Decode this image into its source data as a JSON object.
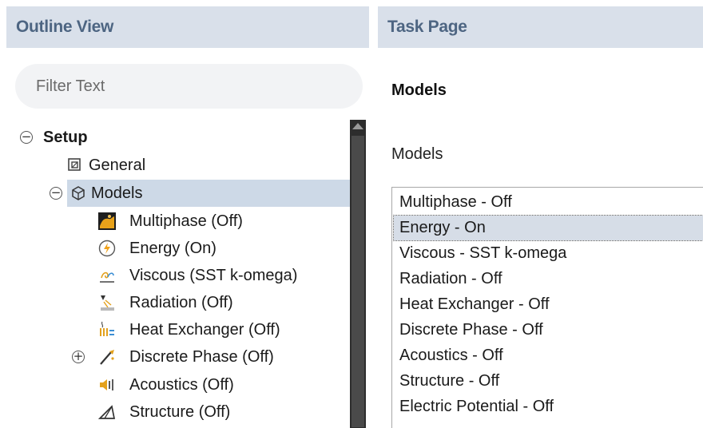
{
  "outline": {
    "title": "Outline View",
    "filter_placeholder": "Filter Text",
    "tree": [
      {
        "label": "Setup",
        "expander": "−",
        "icon": "none"
      },
      {
        "label": "General",
        "icon": "general-icon"
      },
      {
        "label": "Models",
        "expander": "−",
        "icon": "models-icon",
        "selected": true
      },
      {
        "label": "Multiphase (Off)",
        "icon": "multiphase-icon"
      },
      {
        "label": "Energy (On)",
        "icon": "energy-icon"
      },
      {
        "label": "Viscous (SST k-omega)",
        "icon": "viscous-icon"
      },
      {
        "label": "Radiation (Off)",
        "icon": "radiation-icon"
      },
      {
        "label": "Heat Exchanger (Off)",
        "icon": "heat-exchanger-icon"
      },
      {
        "label": "Discrete Phase (Off)",
        "expander": "+",
        "icon": "discrete-phase-icon"
      },
      {
        "label": "Acoustics (Off)",
        "icon": "acoustics-icon"
      },
      {
        "label": "Structure (Off)",
        "icon": "structure-icon"
      }
    ]
  },
  "task": {
    "title": "Task Page",
    "heading": "Models",
    "list_label": "Models",
    "items": [
      {
        "label": "Multiphase - Off"
      },
      {
        "label": "Energy - On",
        "selected": true
      },
      {
        "label": "Viscous - SST k-omega"
      },
      {
        "label": "Radiation - Off"
      },
      {
        "label": "Heat Exchanger - Off"
      },
      {
        "label": "Discrete Phase - Off"
      },
      {
        "label": "Acoustics - Off"
      },
      {
        "label": "Structure - Off"
      },
      {
        "label": "Electric Potential - Off"
      }
    ]
  },
  "colors": {
    "header_bg": "#d9e0ea",
    "header_text": "#4d6582",
    "selection": "#cdd9e7"
  }
}
